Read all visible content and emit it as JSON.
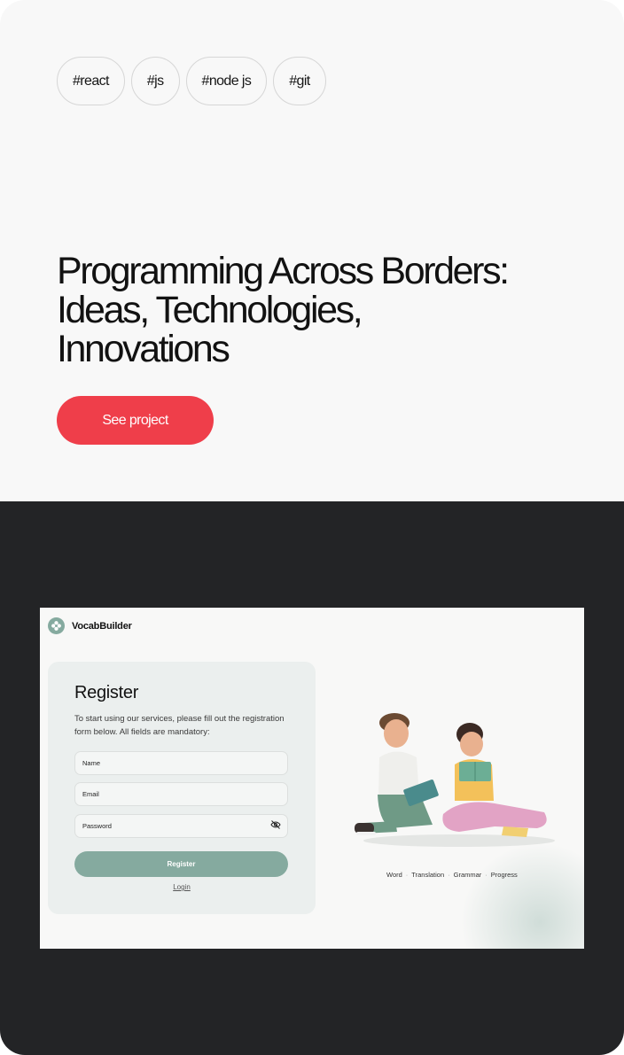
{
  "tags": [
    "#react",
    "#js",
    "#node js",
    "#git"
  ],
  "project": {
    "title": "Programming Across Borders: Ideas, Technologies, Innovations",
    "cta_label": "See project"
  },
  "preview": {
    "brand": "VocabBuilder",
    "register_title": "Register",
    "description": "To start using our services, please fill out the registration form below. All fields are mandatory:",
    "fields": {
      "name_placeholder": "Name",
      "email_placeholder": "Email",
      "password_placeholder": "Password"
    },
    "register_button": "Register",
    "login_link": "Login",
    "features": [
      "Word",
      "Translation",
      "Grammar",
      "Progress"
    ],
    "separator": "·"
  },
  "colors": {
    "accent_red": "#ef3e4a",
    "dark_bg": "#232426",
    "sage": "#85aa9f"
  },
  "icons": {
    "logo": "flower-logo-icon",
    "password_toggle": "eye-slash-icon"
  }
}
